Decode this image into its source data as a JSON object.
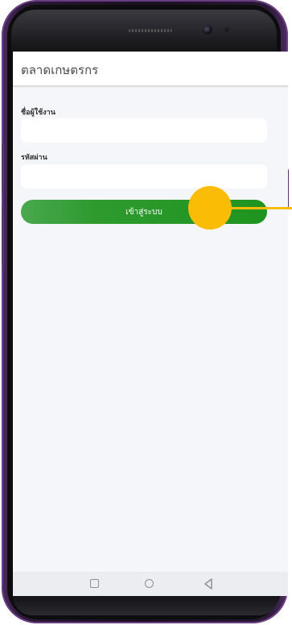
{
  "app": {
    "title": "ตลาดเกษตรกร"
  },
  "login": {
    "username_label": "ชื่อผู้ใช้งาน",
    "username_value": "",
    "password_label": "รหัสผ่าน",
    "password_value": "",
    "submit_label": "เข้าสู่ระบบ"
  },
  "navbar": {
    "recents_icon": "square-icon",
    "home_icon": "circle-icon",
    "back_icon": "triangle-back-icon"
  },
  "colors": {
    "button_green": "#1f941f",
    "touch_indicator": "#fbbc05",
    "phone_frame": "#4a2a5c"
  }
}
